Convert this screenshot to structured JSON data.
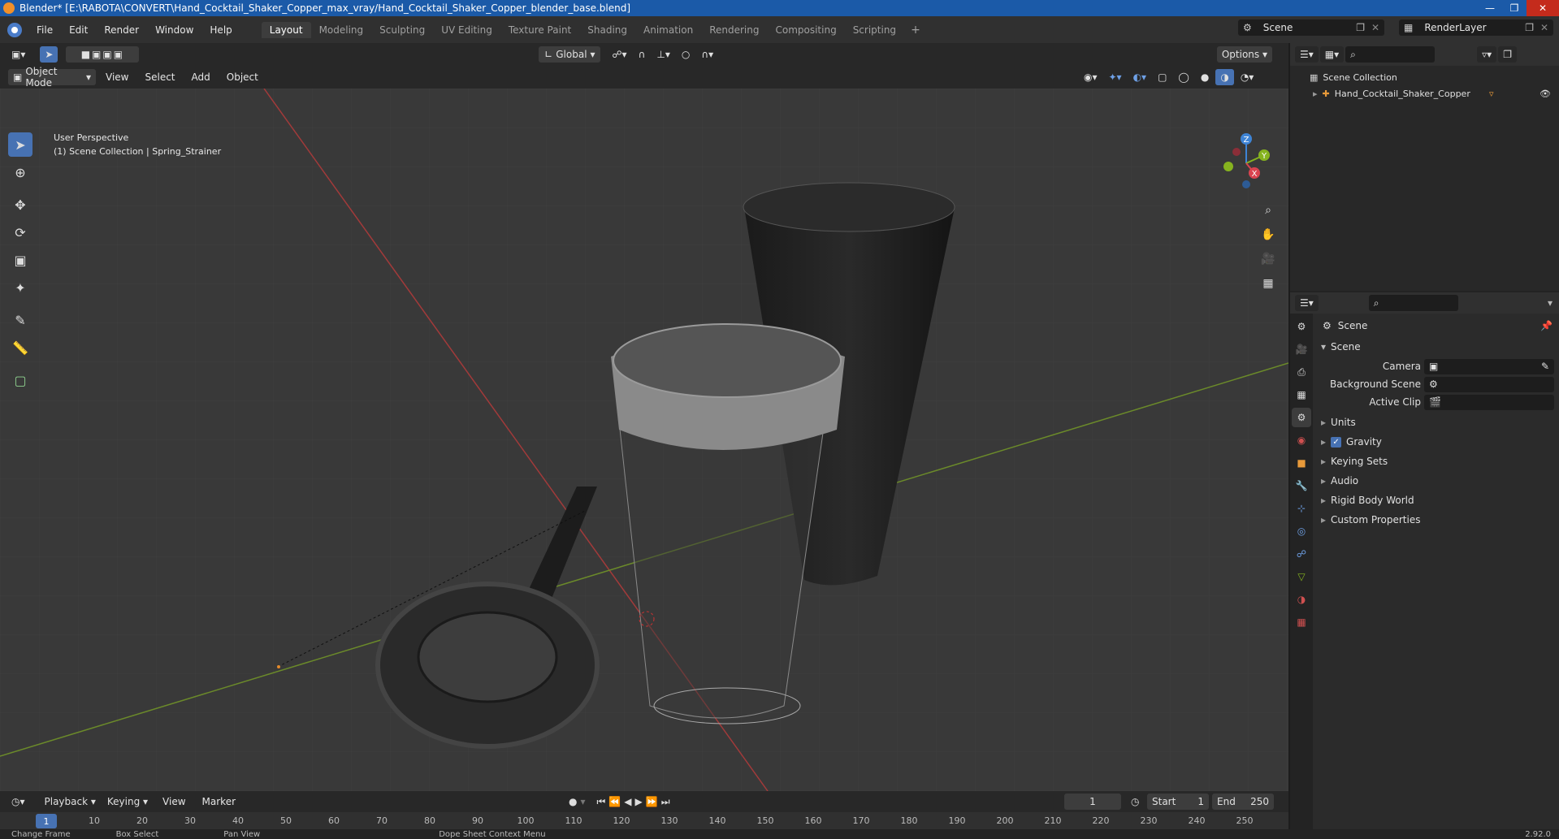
{
  "window": {
    "title": "Blender* [E:\\RABOTA\\CONVERT\\Hand_Cocktail_Shaker_Copper_max_vray/Hand_Cocktail_Shaker_Copper_blender_base.blend]"
  },
  "menu": [
    "File",
    "Edit",
    "Render",
    "Window",
    "Help"
  ],
  "workspaces": [
    "Layout",
    "Modeling",
    "Sculpting",
    "UV Editing",
    "Texture Paint",
    "Shading",
    "Animation",
    "Rendering",
    "Compositing",
    "Scripting"
  ],
  "scene": {
    "name": "Scene",
    "render_layer": "RenderLayer"
  },
  "viewport_header": {
    "mode": "Object Mode",
    "menus": [
      "View",
      "Select",
      "Add",
      "Object"
    ],
    "orientation": "Global",
    "options": "Options"
  },
  "viewport": {
    "perspective": "User Perspective",
    "collection_info": "(1) Scene Collection | Spring_Strainer",
    "gizmo": {
      "x": "X",
      "y": "Y",
      "z": "Z"
    }
  },
  "outliner": {
    "root": "Scene Collection",
    "items": [
      "Hand_Cocktail_Shaker_Copper"
    ]
  },
  "properties": {
    "context": "Scene",
    "panel": "Scene",
    "fields": [
      {
        "label": "Camera",
        "value": ""
      },
      {
        "label": "Background Scene",
        "value": ""
      },
      {
        "label": "Active Clip",
        "value": ""
      }
    ],
    "sections": [
      "Units",
      "Gravity",
      "Keying Sets",
      "Audio",
      "Rigid Body World",
      "Custom Properties"
    ]
  },
  "timeline": {
    "menus": [
      "Playback",
      "Keying",
      "View",
      "Marker"
    ],
    "current_frame": "1",
    "start_label": "Start",
    "start": "1",
    "end_label": "End",
    "end": "250",
    "ticks": [
      "10",
      "20",
      "30",
      "40",
      "50",
      "60",
      "70",
      "80",
      "90",
      "100",
      "110",
      "120",
      "130",
      "140",
      "150",
      "160",
      "170",
      "180",
      "190",
      "200",
      "210",
      "220",
      "230",
      "240",
      "250"
    ]
  },
  "status": {
    "items": [
      "Change Frame",
      "Box Select",
      "Pan View",
      "Dope Sheet Context Menu"
    ],
    "version": "2.92.0"
  },
  "colors": {
    "accent": "#4772b3",
    "x_axis": "#d9434f",
    "y_axis": "#86b31f",
    "z_axis": "#3e84d6"
  }
}
